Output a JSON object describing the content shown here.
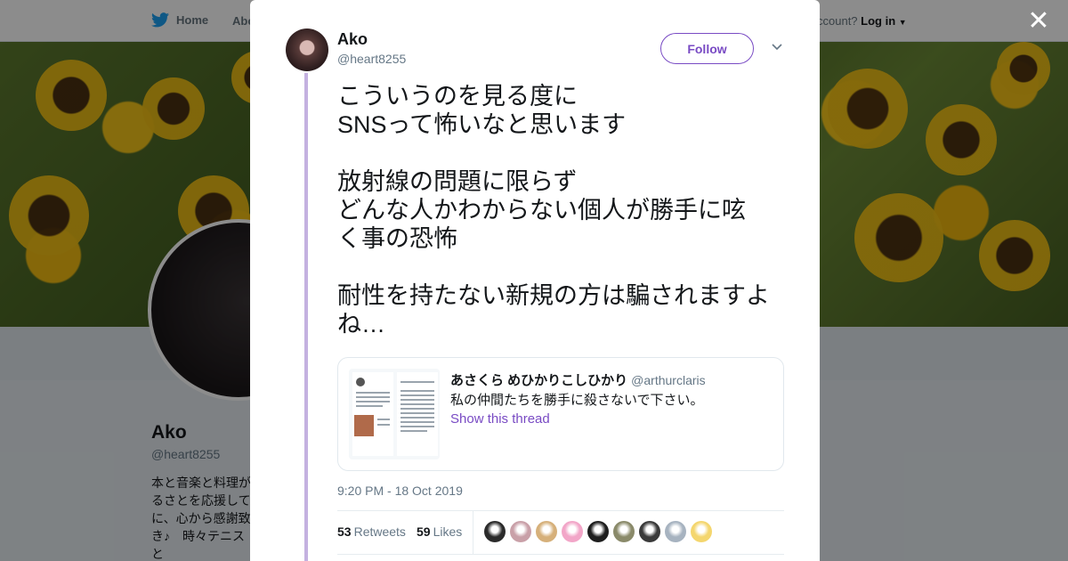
{
  "nav": {
    "home_label": "Home",
    "about_label": "Abo",
    "account_prompt": "ccount?",
    "login_label": "Log in"
  },
  "profile": {
    "name": "Ako",
    "handle": "@heart8255",
    "bio": "本と音楽と料理が\nるさとを応援して\nに、心から感謝致\nき♪　時々テニスと\n雪うさぎ🐰市♪"
  },
  "close_label": "✕",
  "tweet": {
    "author_name": "Ako",
    "author_handle": "@heart8255",
    "follow_label": "Follow",
    "text": "こういうのを見る度に\nSNSって怖いなと思います\n\n放射線の問題に限らず\nどんな人かわからない個人が勝手に呟\nく事の恐怖\n\n耐性を持たない新規の方は騙されますよ\nね…",
    "timestamp": "9:20 PM - 18 Oct 2019",
    "retweets_count": "53",
    "retweets_label": "Retweets",
    "likes_count": "59",
    "likes_label": "Likes"
  },
  "quote": {
    "author_name": "あさくら めひかりこしひかり",
    "author_handle": "@arthurclaris",
    "text": "私の仲間たちを勝手に殺さないで下さい。",
    "link_label": "Show this thread"
  },
  "likers": [
    "#2b2b2b",
    "#c9a0a8",
    "#d6b07a",
    "#f2a6c8",
    "#1e1e1e",
    "#8a8a6a",
    "#3a3a3a",
    "#a7b3c0",
    "#f4d66e"
  ],
  "colors": {
    "accent": "#794bc4",
    "thread_line": "#c4b1e0",
    "brand_bird": "#1da1f2"
  }
}
